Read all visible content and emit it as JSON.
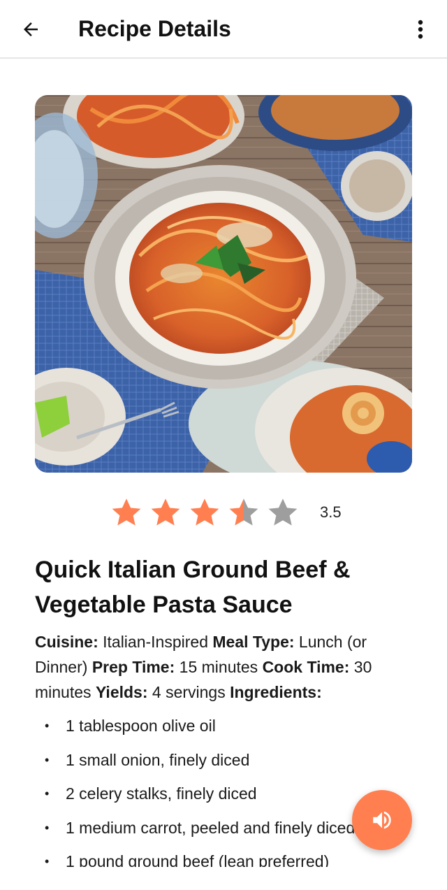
{
  "appbar": {
    "title": "Recipe Details",
    "back_icon": "arrow-left-icon",
    "menu_icon": "more-vertical-icon"
  },
  "hero": {
    "alt": "Spaghetti with meat sauce dish on wooden table"
  },
  "rating": {
    "value_text": "3.5",
    "value": 3.5,
    "max": 5,
    "filled_color": "#ff7f50",
    "empty_color": "#9e9e9e"
  },
  "recipe": {
    "title": "Quick Italian Ground Beef & Vegetable Pasta Sauce",
    "cuisine_label": "Cuisine:",
    "cuisine": "Italian-Inspired",
    "meal_type_label": "Meal Type:",
    "meal_type": "Lunch (or Dinner)",
    "prep_time_label": "Prep Time:",
    "prep_time": "15 minutes",
    "cook_time_label": "Cook Time:",
    "cook_time": "30 minutes",
    "yields_label": "Yields:",
    "yields": "4 servings",
    "ingredients_label": "Ingredients:",
    "ingredients": [
      "1 tablespoon olive oil",
      "1 small onion, finely diced",
      "2 celery stalks, finely diced",
      "1 medium carrot, peeled and finely diced",
      "1 pound ground beef (lean preferred)"
    ]
  },
  "fab": {
    "icon": "volume-icon",
    "color": "#ff7f50"
  }
}
